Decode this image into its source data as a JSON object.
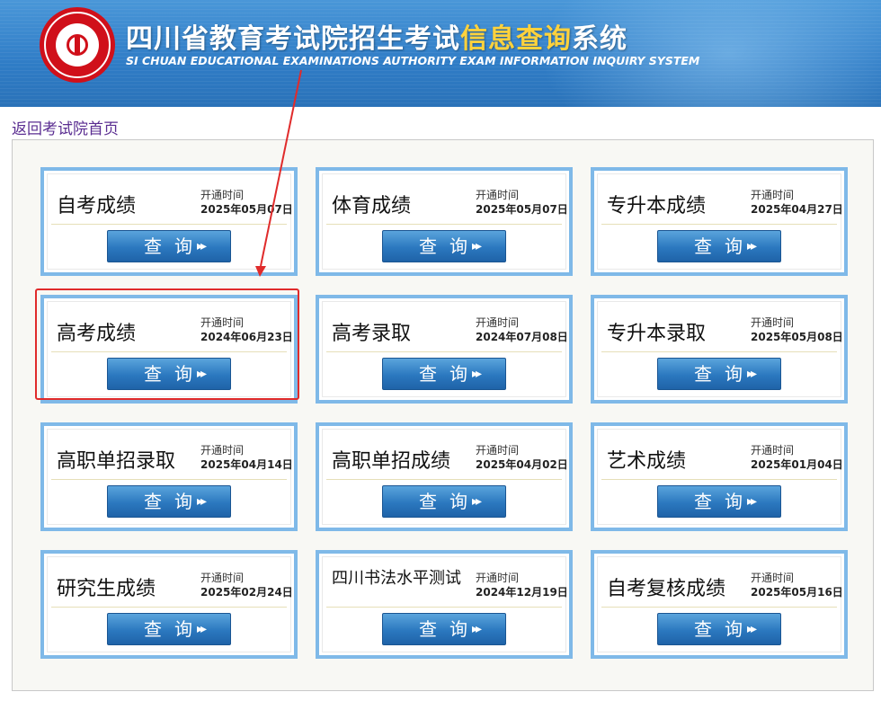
{
  "header": {
    "title_part1": "四川省教育考试院招生考试",
    "title_highlight": "信息查询",
    "title_part2": "系统",
    "subtitle": "SI CHUAN EDUCATIONAL EXAMINATIONS AUTHORITY EXAM INFORMATION INQUIRY SYSTEM"
  },
  "home_link": "返回考试院首页",
  "open_label": "开通时间",
  "query_label": "查询",
  "cards": [
    {
      "name": "自考成绩",
      "date": "2025年05月07日"
    },
    {
      "name": "体育成绩",
      "date": "2025年05月07日"
    },
    {
      "name": "专升本成绩",
      "date": "2025年04月27日"
    },
    {
      "name": "高考成绩",
      "date": "2024年06月23日"
    },
    {
      "name": "高考录取",
      "date": "2024年07月08日"
    },
    {
      "name": "专升本录取",
      "date": "2025年05月08日"
    },
    {
      "name": "高职单招录取",
      "date": "2025年04月14日"
    },
    {
      "name": "高职单招成绩",
      "date": "2025年04月02日"
    },
    {
      "name": "艺术成绩",
      "date": "2025年01月04日"
    },
    {
      "name": "研究生成绩",
      "date": "2025年02月24日"
    },
    {
      "name": "四川书法水平测试",
      "date": "2024年12月19日"
    },
    {
      "name": "自考复核成绩",
      "date": "2025年05月16日"
    }
  ],
  "colors": {
    "accent": "#2b78bf",
    "highlight": "#e02b2b",
    "title_highlight": "#ffd23c"
  }
}
